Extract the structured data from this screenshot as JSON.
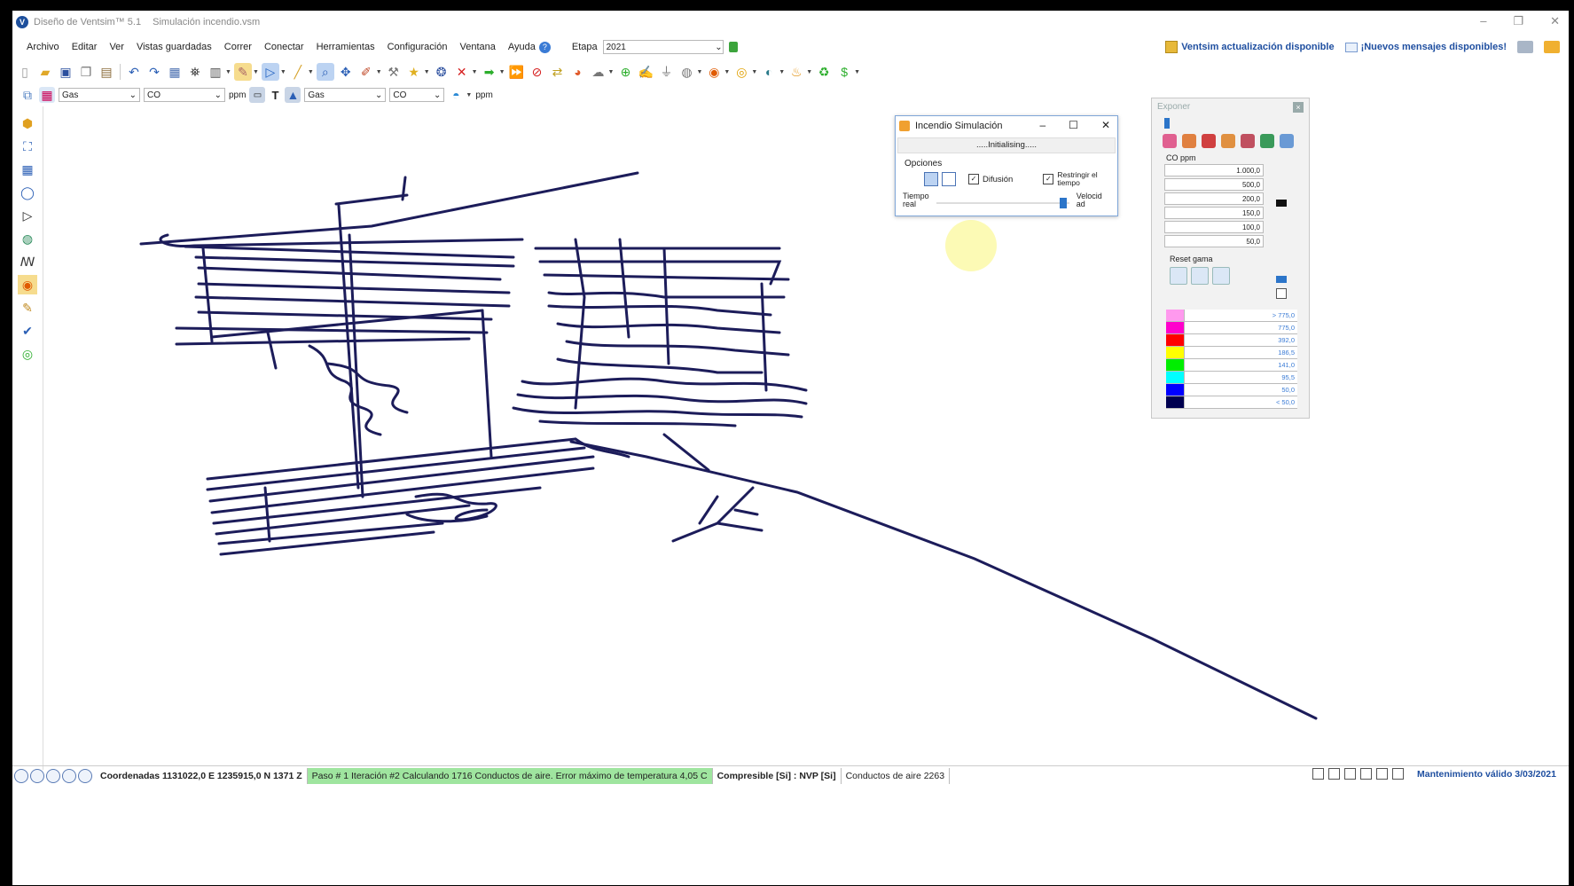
{
  "window": {
    "app_name": "Diseño de Ventsim™ 5.1",
    "file_name": "Simulación incendio.vsm",
    "controls": [
      "–",
      "❐",
      "✕"
    ]
  },
  "menu": {
    "items": [
      "Archivo",
      "Editar",
      "Ver",
      "Vistas guardadas",
      "Correr",
      "Conectar",
      "Herramientas",
      "Configuración",
      "Ventana",
      "Ayuda"
    ],
    "help_badge": "?",
    "etapa_label": "Etapa",
    "etapa_value": "2021",
    "update_notice": "Ventsim actualización disponible",
    "messages_notice": "¡Nuevos mensajes disponibles!"
  },
  "toolbar2": {
    "left_select_1": "Gas",
    "left_select_2": "CO",
    "left_unit": "ppm",
    "text_tool": "T",
    "right_select_1": "Gas",
    "right_select_2": "CO",
    "right_unit": "ppm"
  },
  "fire_dialog": {
    "title": "Incendio Simulación",
    "status": ".....Initialising.....",
    "options_label": "Opciones",
    "difusion_label": "Difusión",
    "difusion_checked": true,
    "restrict_label_1": "Restringir el",
    "restrict_label_2": "tiempo",
    "restrict_checked": true,
    "tiempo_1": "Tiempo",
    "tiempo_2": "real",
    "velocidad_1": "Velocid",
    "velocidad_2": "ad",
    "speed_fraction": 0.98,
    "check_glyph": "✓"
  },
  "exponer": {
    "title": "Exponer",
    "close": "×",
    "gas_label": "CO ppm",
    "values": [
      "1.000,0",
      "500,0",
      "200,0",
      "150,0",
      "100,0",
      "50,0"
    ],
    "reset_label": "Reset gama",
    "legend": [
      {
        "color": "#ff99ee",
        "label": "> 775,0"
      },
      {
        "color": "#ff00cc",
        "label": "775,0"
      },
      {
        "color": "#ff0000",
        "label": "392,0"
      },
      {
        "color": "#ffff00",
        "label": "186,5"
      },
      {
        "color": "#00ee00",
        "label": "141,0"
      },
      {
        "color": "#00ffff",
        "label": "95,5"
      },
      {
        "color": "#0000ff",
        "label": "50,0"
      },
      {
        "color": "#000050",
        "label": "< 50,0"
      }
    ]
  },
  "status": {
    "coordinates": "Coordenadas 1131022,0 E   1235915,0 N   1371 Z",
    "progress": "Paso # 1  Iteración #2  Calculando 1716 Conductos de aire.  Error máximo de temperatura  4,05 C",
    "compressible": "Compresible [Si] : NVP [Si]",
    "airways": "Conductos de aire 2263",
    "maintenance": "Mantenimiento válido 3/03/2021"
  },
  "colors": {
    "network": "#1c1c5a",
    "accent": "#1f4fa0",
    "status_green": "#9fe59f"
  }
}
